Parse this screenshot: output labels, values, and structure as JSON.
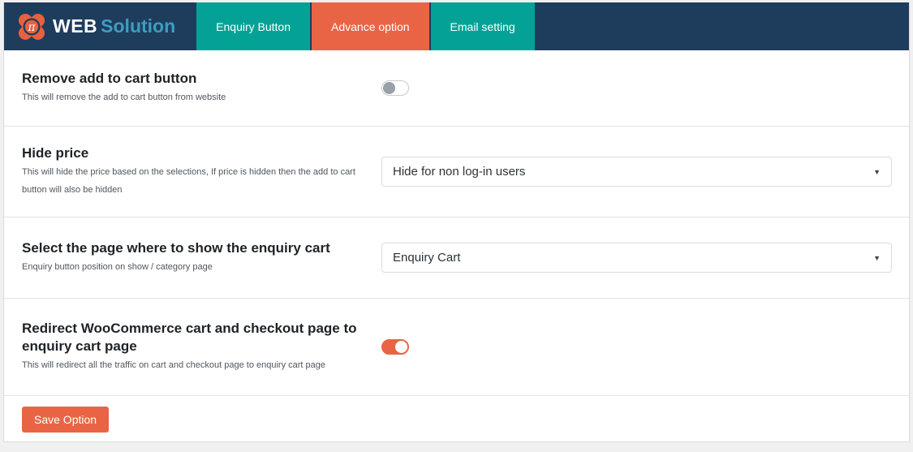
{
  "header": {
    "brand": {
      "logo_icon": "pi-x-logo",
      "title_bold": "WEB",
      "title_light": "Solution"
    },
    "tabs": [
      {
        "label": "Enquiry Button",
        "active": false
      },
      {
        "label": "Advance option",
        "active": true
      },
      {
        "label": "Email setting",
        "active": false
      }
    ]
  },
  "settings": [
    {
      "title": "Remove add to cart button",
      "description": "This will remove the add to cart button from website",
      "control": "toggle",
      "value": false
    },
    {
      "title": "Hide price",
      "description": "This will hide the price based on the selections, If price is hidden then the add to cart button will also be hidden",
      "control": "select",
      "value": "Hide for non log-in users",
      "arrow_icon": "dropdown-arrow-icon",
      "arrow_glyph": "▼"
    },
    {
      "title": "Select the page where to show the enquiry cart",
      "description": "Enquiry button position on show / category page",
      "control": "select",
      "value": "Enquiry Cart",
      "arrow_icon": "dropdown-arrow-icon",
      "arrow_glyph": "▼"
    },
    {
      "title": "Redirect WooCommerce cart and checkout page to enquiry cart page",
      "description": "This will redirect all the traffic on cart and checkout page to enquiry cart page",
      "control": "toggle",
      "value": true
    }
  ],
  "save_button": {
    "label": "Save Option"
  },
  "colors": {
    "header_bg": "#1e3d5c",
    "tab_teal": "#04a296",
    "accent_orange": "#e96445",
    "brand_solution_text": "#3d9dc2",
    "page_bg": "#f0f0f1"
  }
}
